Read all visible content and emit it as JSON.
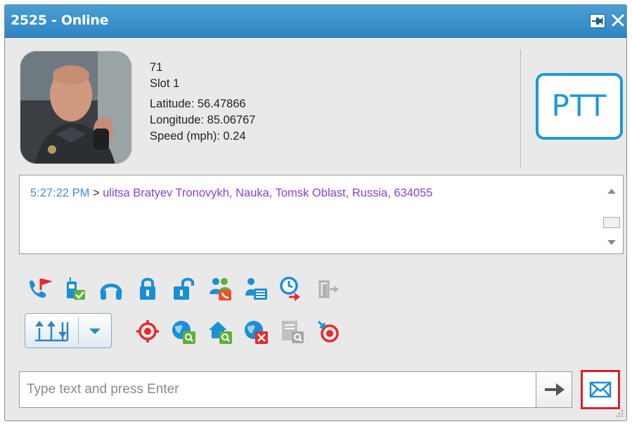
{
  "window": {
    "title": "2525 - Online",
    "buttons": {
      "pin": "pin-icon",
      "close": "close-icon"
    }
  },
  "subscriber": {
    "id": "71",
    "slot": "Slot 1",
    "latitude": "Latitude: 56.47866",
    "longitude": "Longitude: 85.06767",
    "speed": "Speed (mph): 0.24",
    "photo": "avatar-photo"
  },
  "ptt": {
    "label": "PTT"
  },
  "log": {
    "entries": [
      {
        "time": "5:27:22 PM",
        "sep": " > ",
        "text": "ulitsa Bratyev Tronovykh, Nauka, Tomsk Oblast, Russia, 634055"
      }
    ]
  },
  "toolbar": {
    "row1": [
      "call-alert-icon",
      "radio-check-icon",
      "remote-monitor-icon",
      "lock-icon",
      "unlock-icon",
      "group-call-icon",
      "contact-card-icon",
      "schedule-location-icon",
      "exit-icon"
    ],
    "row2": [
      "location-split-icon",
      "dropdown-icon",
      "single-location-icon",
      "globe-search-icon",
      "home-search-icon",
      "globe-remove-icon",
      "report-search-icon",
      "stop-location-icon"
    ]
  },
  "composer": {
    "placeholder": "Type text and press Enter",
    "send_icon": "send-arrow-icon",
    "mail_icon": "mail-icon"
  },
  "colors": {
    "accent": "#1b9ad6",
    "title_bar": "#3a93cc",
    "time_text": "#3b8fd3",
    "address_text": "#8b3fd6",
    "highlight": "#d92128"
  }
}
